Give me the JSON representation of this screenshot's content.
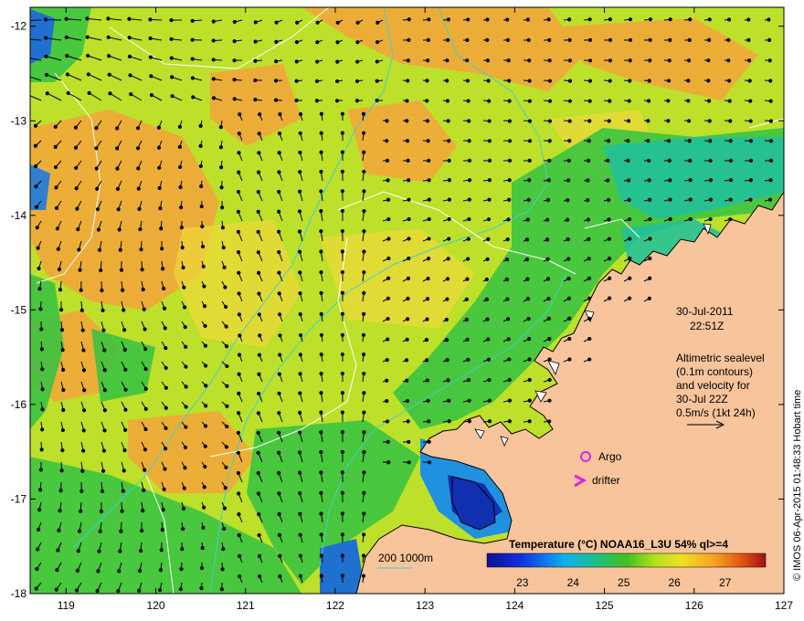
{
  "axes": {
    "lon_ticks": [
      "119",
      "120",
      "121",
      "122",
      "123",
      "124",
      "125",
      "126",
      "127"
    ],
    "lat_ticks": [
      "-12",
      "-13",
      "-14",
      "-15",
      "-16",
      "-17",
      "-18"
    ],
    "lon_range": [
      118.6,
      127
    ],
    "lat_range": [
      -11.8,
      -18
    ]
  },
  "annotation": {
    "date": "30-Jul-2011",
    "time": "22:51Z",
    "alt_line1": "Altimetric sealevel",
    "alt_line2": "(0.1m contours)",
    "alt_line3": "and velocity for",
    "alt_line4": "30-Jul 22Z",
    "alt_line5": "0.5m/s (1kt 24h)"
  },
  "markers": {
    "argo_label": "Argo",
    "drifter_label": "drifter",
    "argo_color": "#e020e0",
    "drifter_color": "#e020e0"
  },
  "bathymetry_legend": {
    "label": "200  1000m",
    "color": "#40d0d0"
  },
  "colorbar": {
    "title": "Temperature (°C) NOAA16_L3U 54% ql>=4",
    "ticks": [
      "23",
      "24",
      "25",
      "26",
      "27"
    ],
    "range": [
      22.3,
      27.8
    ]
  },
  "credit": "© IMOS 06-Apr-2015 01:48:33 Hobart time",
  "colors": {
    "land": "#f7c49c",
    "sst_warm": "#f5a42a",
    "sst_mid": "#d0e020",
    "sst_cool": "#30c040",
    "sst_cold": "#1040c0"
  }
}
